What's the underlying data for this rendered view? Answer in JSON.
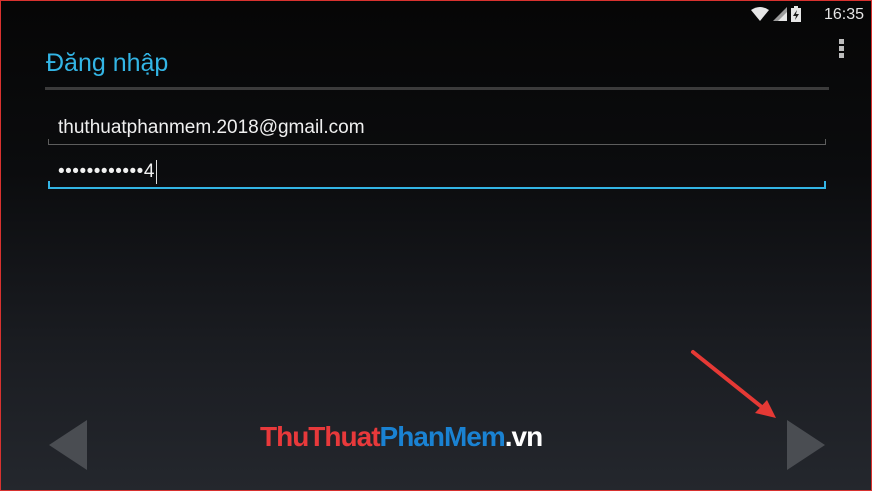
{
  "status_bar": {
    "time": "16:35",
    "icons": [
      "wifi-icon",
      "signal-icon",
      "battery-charging-icon"
    ]
  },
  "header": {
    "title": "Đăng nhập"
  },
  "form": {
    "email_value": "thuthuatphanmem.2018@gmail.com",
    "password_value": "••••••••••••4"
  },
  "navigation": {
    "back_icon": "left-triangle-icon",
    "next_icon": "right-triangle-icon"
  },
  "watermark": {
    "part1": "ThuThuat",
    "part2": "PhanMem",
    "part3": ".vn"
  },
  "colors": {
    "accent": "#33b5e5",
    "annotation_arrow": "#e53935",
    "frame_border": "#d8322f"
  }
}
